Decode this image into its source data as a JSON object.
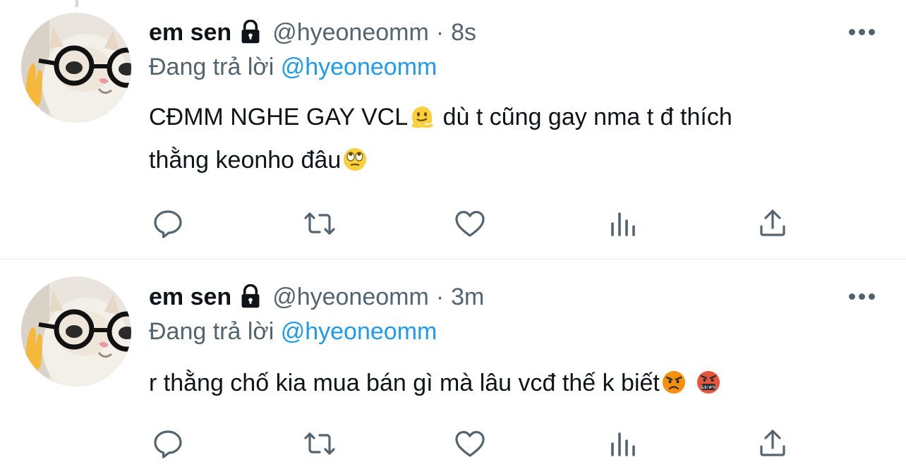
{
  "tweets": [
    {
      "author_name": "em sen",
      "handle": "@hyeoneomm",
      "separator": "·",
      "time": "8s",
      "reply_prefix": "Đang trả lời",
      "reply_mention": "@hyeoneomm",
      "text_line1": "CĐMM NGHE GAY VCL",
      "text_line1_rest": " dù t cũng gay nma t đ thích",
      "text_line2": "thằng keonho đâu",
      "emojis": [
        "melting-face-emoji",
        "eye-roll-emoji"
      ]
    },
    {
      "author_name": "em sen",
      "handle": "@hyeoneomm",
      "separator": "·",
      "time": "3m",
      "reply_prefix": "Đang trả lời",
      "reply_mention": "@hyeoneomm",
      "text_line1": "r thằng chố kia mua bán gì mà lâu vcđ thế k biết",
      "emojis": [
        "angry-face-emoji",
        "cursing-face-emoji"
      ]
    }
  ],
  "icons": [
    "lock-icon",
    "more-icon",
    "reply-icon",
    "retweet-icon",
    "like-icon",
    "views-icon",
    "share-icon"
  ],
  "colors": {
    "text": "#0f1419",
    "muted": "#536471",
    "accent": "#1d9bf0",
    "divider": "#eff3f4"
  }
}
